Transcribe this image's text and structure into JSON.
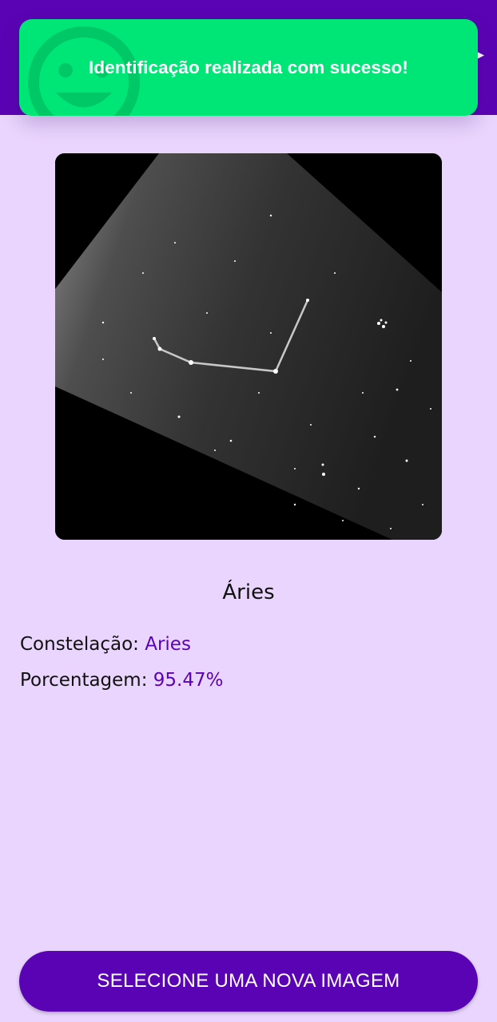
{
  "toast": {
    "message": "Identificação realizada com sucesso!",
    "icon": "smile-icon",
    "color": "#00e676"
  },
  "header": {
    "color": "#5a03b4",
    "icon": "play-arrow-icon"
  },
  "result": {
    "title": "Áries",
    "constellation_label": "Constelação:",
    "constellation_value": "Aries",
    "percentage_label": "Porcentagem:",
    "percentage_value": "95.47%",
    "accent_color": "#5a03b4"
  },
  "actions": {
    "select_new_image_label": "SELECIONE UMA NOVA IMAGEM"
  }
}
